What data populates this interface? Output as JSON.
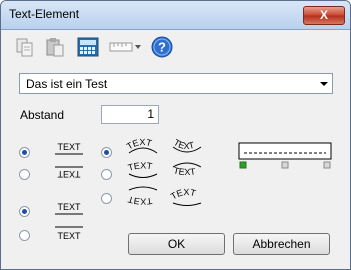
{
  "window": {
    "title": "Text-Element",
    "close_glyph": "X"
  },
  "toolbar": {
    "tools": [
      "copy-icon",
      "paste-icon",
      "calculator-icon",
      "ruler-dropdown-icon",
      "help-icon"
    ],
    "help_glyph": "?"
  },
  "text_select": {
    "value": "Das ist ein Test"
  },
  "spacing": {
    "label": "Abstand",
    "value": "1"
  },
  "options": {
    "col1": [
      {
        "sample": "TEXT",
        "checked": true,
        "style": "upright"
      },
      {
        "sample": "TEXT",
        "checked": false,
        "style": "mirrored"
      }
    ],
    "col2": [
      {
        "samples": [
          "TEXT",
          "TEXT"
        ],
        "checked": true
      },
      {
        "samples": [
          "TEXT",
          "TEXT"
        ],
        "checked": false
      },
      {
        "samples": [
          "TEXT",
          "TEXT"
        ],
        "checked": false
      }
    ],
    "col1_bottom": [
      {
        "sample": "TEXT",
        "checked": true
      },
      {
        "sample": "TEXT",
        "checked": false
      }
    ]
  },
  "buttons": {
    "ok": "OK",
    "cancel": "Abbrechen"
  },
  "colors": {
    "accent": "#1f4ea8",
    "green_marker": "#2aa02a"
  }
}
